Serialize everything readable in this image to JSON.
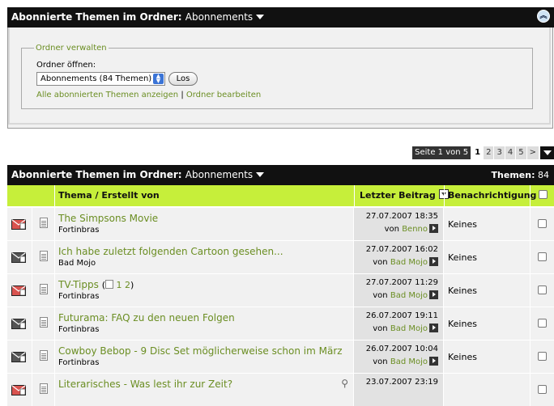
{
  "folder_header": {
    "title": "Abonnierte Themen im Ordner",
    "folder": "Abonnements"
  },
  "manage": {
    "legend": "Ordner verwalten",
    "open_label": "Ordner öffnen:",
    "select_value": "Abonnements (84 Themen)",
    "go_label": "Los",
    "link_show_all": "Alle abonnierten Themen anzeigen",
    "separator": "|",
    "link_edit": "Ordner bearbeiten"
  },
  "pager": {
    "info": "Seite 1 von 5",
    "pages": [
      "1",
      "2",
      "3",
      "4",
      "5",
      ">"
    ]
  },
  "list_header": {
    "title": "Abonnierte Themen im Ordner",
    "folder": "Abonnements",
    "count_label": "Themen:",
    "count_value": "84"
  },
  "columns": {
    "topic": "Thema / Erstellt von",
    "last_post": "Letzter Beitrag",
    "notification": "Benachrichtigung"
  },
  "rows": [
    {
      "title": "The Simpsons Movie",
      "author": "Fortinbras",
      "date": "27.07.2007 18:35",
      "by_prefix": "von",
      "by": "Benno",
      "notify": "Keines",
      "new": true
    },
    {
      "title": "Ich habe zuletzt folgenden Cartoon gesehen...",
      "author": "Bad Mojo",
      "date": "27.07.2007 16:02",
      "by_prefix": "von",
      "by": "Bad Mojo",
      "notify": "Keines",
      "new": false
    },
    {
      "title": "TV-Tipps",
      "pages_open": "(",
      "page1": "1",
      "page2": "2",
      "pages_close": ")",
      "author": "Fortinbras",
      "date": "27.07.2007 11:29",
      "by_prefix": "von",
      "by": "Bad Mojo",
      "notify": "Keines",
      "new": true
    },
    {
      "title": "Futurama: FAQ zu den neuen Folgen",
      "author": "Fortinbras",
      "date": "26.07.2007 19:11",
      "by_prefix": "von",
      "by": "Bad Mojo",
      "notify": "Keines",
      "new": false
    },
    {
      "title": "Cowboy Bebop - 9 Disc Set möglicherweise schon im März",
      "author": "Fortinbras",
      "date": "26.07.2007 10:04",
      "by_prefix": "von",
      "by": "Bad Mojo",
      "notify": "Keines",
      "new": false
    },
    {
      "title": "Literarisches - Was lest ihr zur Zeit?",
      "author": "",
      "date": "23.07.2007 23:19",
      "by_prefix": "",
      "by": "",
      "notify": "",
      "new": true
    }
  ],
  "colors": {
    "accent": "#6b8e23",
    "header_bg": "#c6ef3a",
    "bar_bg": "#111111"
  }
}
